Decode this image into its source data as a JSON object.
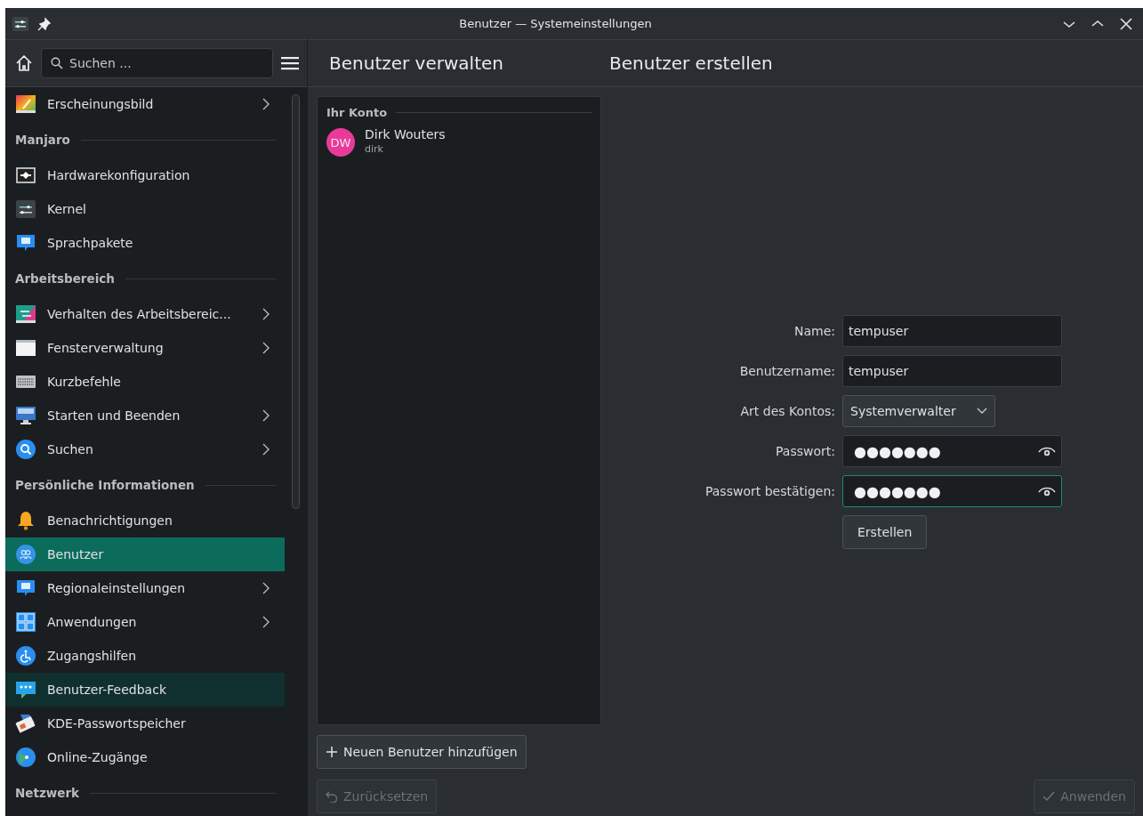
{
  "window": {
    "title": "Benutzer — Systemeinstellungen"
  },
  "sidebar": {
    "search": {
      "placeholder": "Suchen ..."
    },
    "items": [
      {
        "kind": "item",
        "label": "Erscheinungsbild",
        "has_submenu": true,
        "selected": false,
        "hovered": false
      },
      {
        "kind": "section",
        "label": "Manjaro"
      },
      {
        "kind": "item",
        "label": "Hardwarekonfiguration",
        "has_submenu": false,
        "selected": false,
        "hovered": false
      },
      {
        "kind": "item",
        "label": "Kernel",
        "has_submenu": false,
        "selected": false,
        "hovered": false
      },
      {
        "kind": "item",
        "label": "Sprachpakete",
        "has_submenu": false,
        "selected": false,
        "hovered": false
      },
      {
        "kind": "section",
        "label": "Arbeitsbereich"
      },
      {
        "kind": "item",
        "label": "Verhalten des Arbeitsbereic...",
        "has_submenu": true,
        "selected": false,
        "hovered": false
      },
      {
        "kind": "item",
        "label": "Fensterverwaltung",
        "has_submenu": true,
        "selected": false,
        "hovered": false
      },
      {
        "kind": "item",
        "label": "Kurzbefehle",
        "has_submenu": false,
        "selected": false,
        "hovered": false
      },
      {
        "kind": "item",
        "label": "Starten und Beenden",
        "has_submenu": true,
        "selected": false,
        "hovered": false
      },
      {
        "kind": "item",
        "label": "Suchen",
        "has_submenu": true,
        "selected": false,
        "hovered": false
      },
      {
        "kind": "section",
        "label": "Persönliche Informationen"
      },
      {
        "kind": "item",
        "label": "Benachrichtigungen",
        "has_submenu": false,
        "selected": false,
        "hovered": false
      },
      {
        "kind": "item",
        "label": "Benutzer",
        "has_submenu": false,
        "selected": true,
        "hovered": false
      },
      {
        "kind": "item",
        "label": "Regionaleinstellungen",
        "has_submenu": true,
        "selected": false,
        "hovered": false
      },
      {
        "kind": "item",
        "label": "Anwendungen",
        "has_submenu": true,
        "selected": false,
        "hovered": false
      },
      {
        "kind": "item",
        "label": "Zugangshilfen",
        "has_submenu": false,
        "selected": false,
        "hovered": false
      },
      {
        "kind": "item",
        "label": "Benutzer-Feedback",
        "has_submenu": false,
        "selected": false,
        "hovered": true
      },
      {
        "kind": "item",
        "label": "KDE-Passwortspeicher",
        "has_submenu": false,
        "selected": false,
        "hovered": false
      },
      {
        "kind": "item",
        "label": "Online-Zugänge",
        "has_submenu": false,
        "selected": false,
        "hovered": false
      },
      {
        "kind": "section",
        "label": "Netzwerk"
      }
    ]
  },
  "manage": {
    "title": "Benutzer verwalten",
    "section": "Ihr Konto",
    "users": [
      {
        "initials": "DW",
        "name": "Dirk Wouters",
        "login": "dirk",
        "color": "#e93a9a"
      }
    ],
    "add_button": "Neuen Benutzer hinzufügen"
  },
  "create": {
    "title": "Benutzer erstellen",
    "fields": [
      {
        "kind": "text",
        "label": "Name:",
        "value": "tempuser",
        "focused": false
      },
      {
        "kind": "text",
        "label": "Benutzername:",
        "value": "tempuser",
        "focused": false
      },
      {
        "kind": "combo",
        "label": "Art des Kontos:",
        "value": "Systemverwalter",
        "focused": false
      },
      {
        "kind": "password",
        "label": "Passwort:",
        "value": "●●●●●●●",
        "focused": false
      },
      {
        "kind": "password",
        "label": "Passwort bestätigen:",
        "value": "●●●●●●●",
        "focused": true
      }
    ],
    "submit": "Erstellen"
  },
  "footer": {
    "buttons": [
      {
        "kind": "reset",
        "label": "Zurücksetzen",
        "disabled": true
      },
      {
        "kind": "apply",
        "label": "Anwenden",
        "disabled": true
      }
    ]
  }
}
